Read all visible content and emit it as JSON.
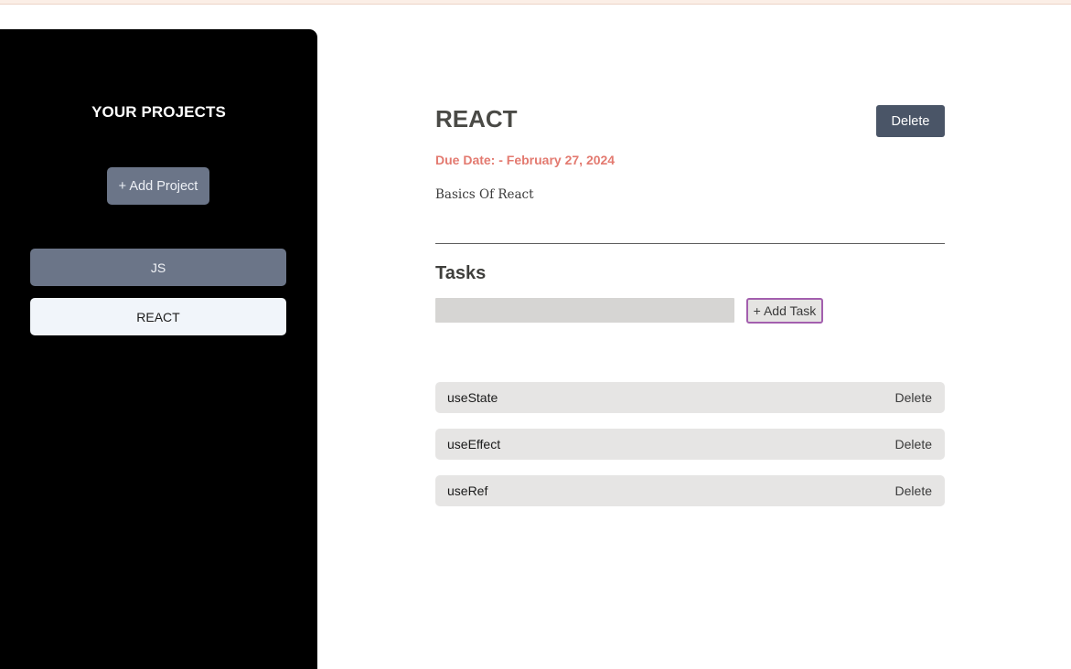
{
  "sidebar": {
    "title": "YOUR PROJECTS",
    "add_project_label": "+ Add Project",
    "projects": [
      {
        "label": "JS",
        "selected": false
      },
      {
        "label": "REACT",
        "selected": true
      }
    ]
  },
  "project": {
    "title": "REACT",
    "delete_label": "Delete",
    "due_date": "Due Date: - February 27, 2024",
    "description": "Basics Of React"
  },
  "tasks": {
    "heading": "Tasks",
    "input_value": "",
    "add_task_label": "+ Add Task",
    "items": [
      {
        "name": "useState",
        "delete_label": "Delete"
      },
      {
        "name": "useEffect",
        "delete_label": "Delete"
      },
      {
        "name": "useRef",
        "delete_label": "Delete"
      }
    ]
  },
  "colors": {
    "sidebar_bg": "#000000",
    "accent_slate": "#6b7588",
    "delete_button_bg": "#4a5567",
    "due_date": "#e37a70",
    "add_task_border": "#a35fae"
  }
}
